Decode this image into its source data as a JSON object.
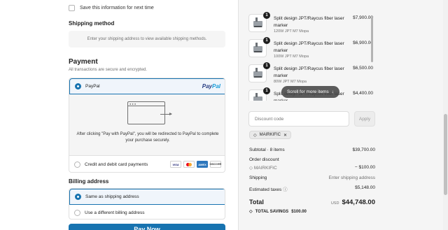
{
  "contact": {
    "save_info_label": "Save this information for next time"
  },
  "shipping": {
    "title": "Shipping method",
    "placeholder": "Enter your shipping address to view available shipping methods."
  },
  "payment": {
    "title": "Payment",
    "subtitle": "All transactions are secure and encrypted.",
    "paypal_label": "PayPal",
    "paypal_logo_a": "Pay",
    "paypal_logo_b": "Pal",
    "paypal_redirect": "After clicking \"Pay with PayPal\", you will be redirected to PayPal to complete your purchase securely.",
    "card_label": "Credit and debit card payments",
    "card_brands": [
      "VISA",
      "",
      "AMEX",
      "DISCOVER"
    ]
  },
  "billing": {
    "title": "Billing address",
    "same_label": "Same as shipping address",
    "different_label": "Use a different billing address"
  },
  "pay_button": "Pay Now",
  "order": {
    "items": [
      {
        "qty": "1",
        "name": "Split design JPT/Raycus fiber laser marker",
        "variant": "120W JPT M7 Mopa",
        "price": "$7,900.00"
      },
      {
        "qty": "1",
        "name": "Split design JPT/Raycus fiber laser marker",
        "variant": "100W JPT M7 Mopa",
        "price": "$6,900.00"
      },
      {
        "qty": "1",
        "name": "Split design JPT/Raycus fiber laser marker",
        "variant": "80W JPT M7 Mopa",
        "price": "$6,500.00"
      },
      {
        "qty": "1",
        "name": "Split design JPT/Raycus fiber laser marker",
        "variant": "",
        "price": "$4,400.00"
      }
    ],
    "scroll_hint": "Scroll for more items",
    "discount_placeholder": "Discount code",
    "apply_label": "Apply",
    "applied_code": "MAIRKIFIC",
    "subtotal_label": "Subtotal · 8 items",
    "subtotal_value": "$39,700.00",
    "order_discount_label": "Order discount",
    "discount_code": "MAIRKIFIC",
    "discount_value": "− $100.00",
    "shipping_label": "Shipping",
    "shipping_value": "Enter shipping address",
    "taxes_label": "Estimated taxes",
    "taxes_value": "$5,148.00",
    "total_label": "Total",
    "total_currency": "USD",
    "total_value": "$44,748.00",
    "savings_label": "TOTAL SAVINGS",
    "savings_value": "$100.00"
  },
  "icons": [
    "check-icon",
    "window-icon",
    "arrow-right-icon",
    "tag-icon",
    "close-icon",
    "info-icon",
    "arrow-down-icon"
  ]
}
